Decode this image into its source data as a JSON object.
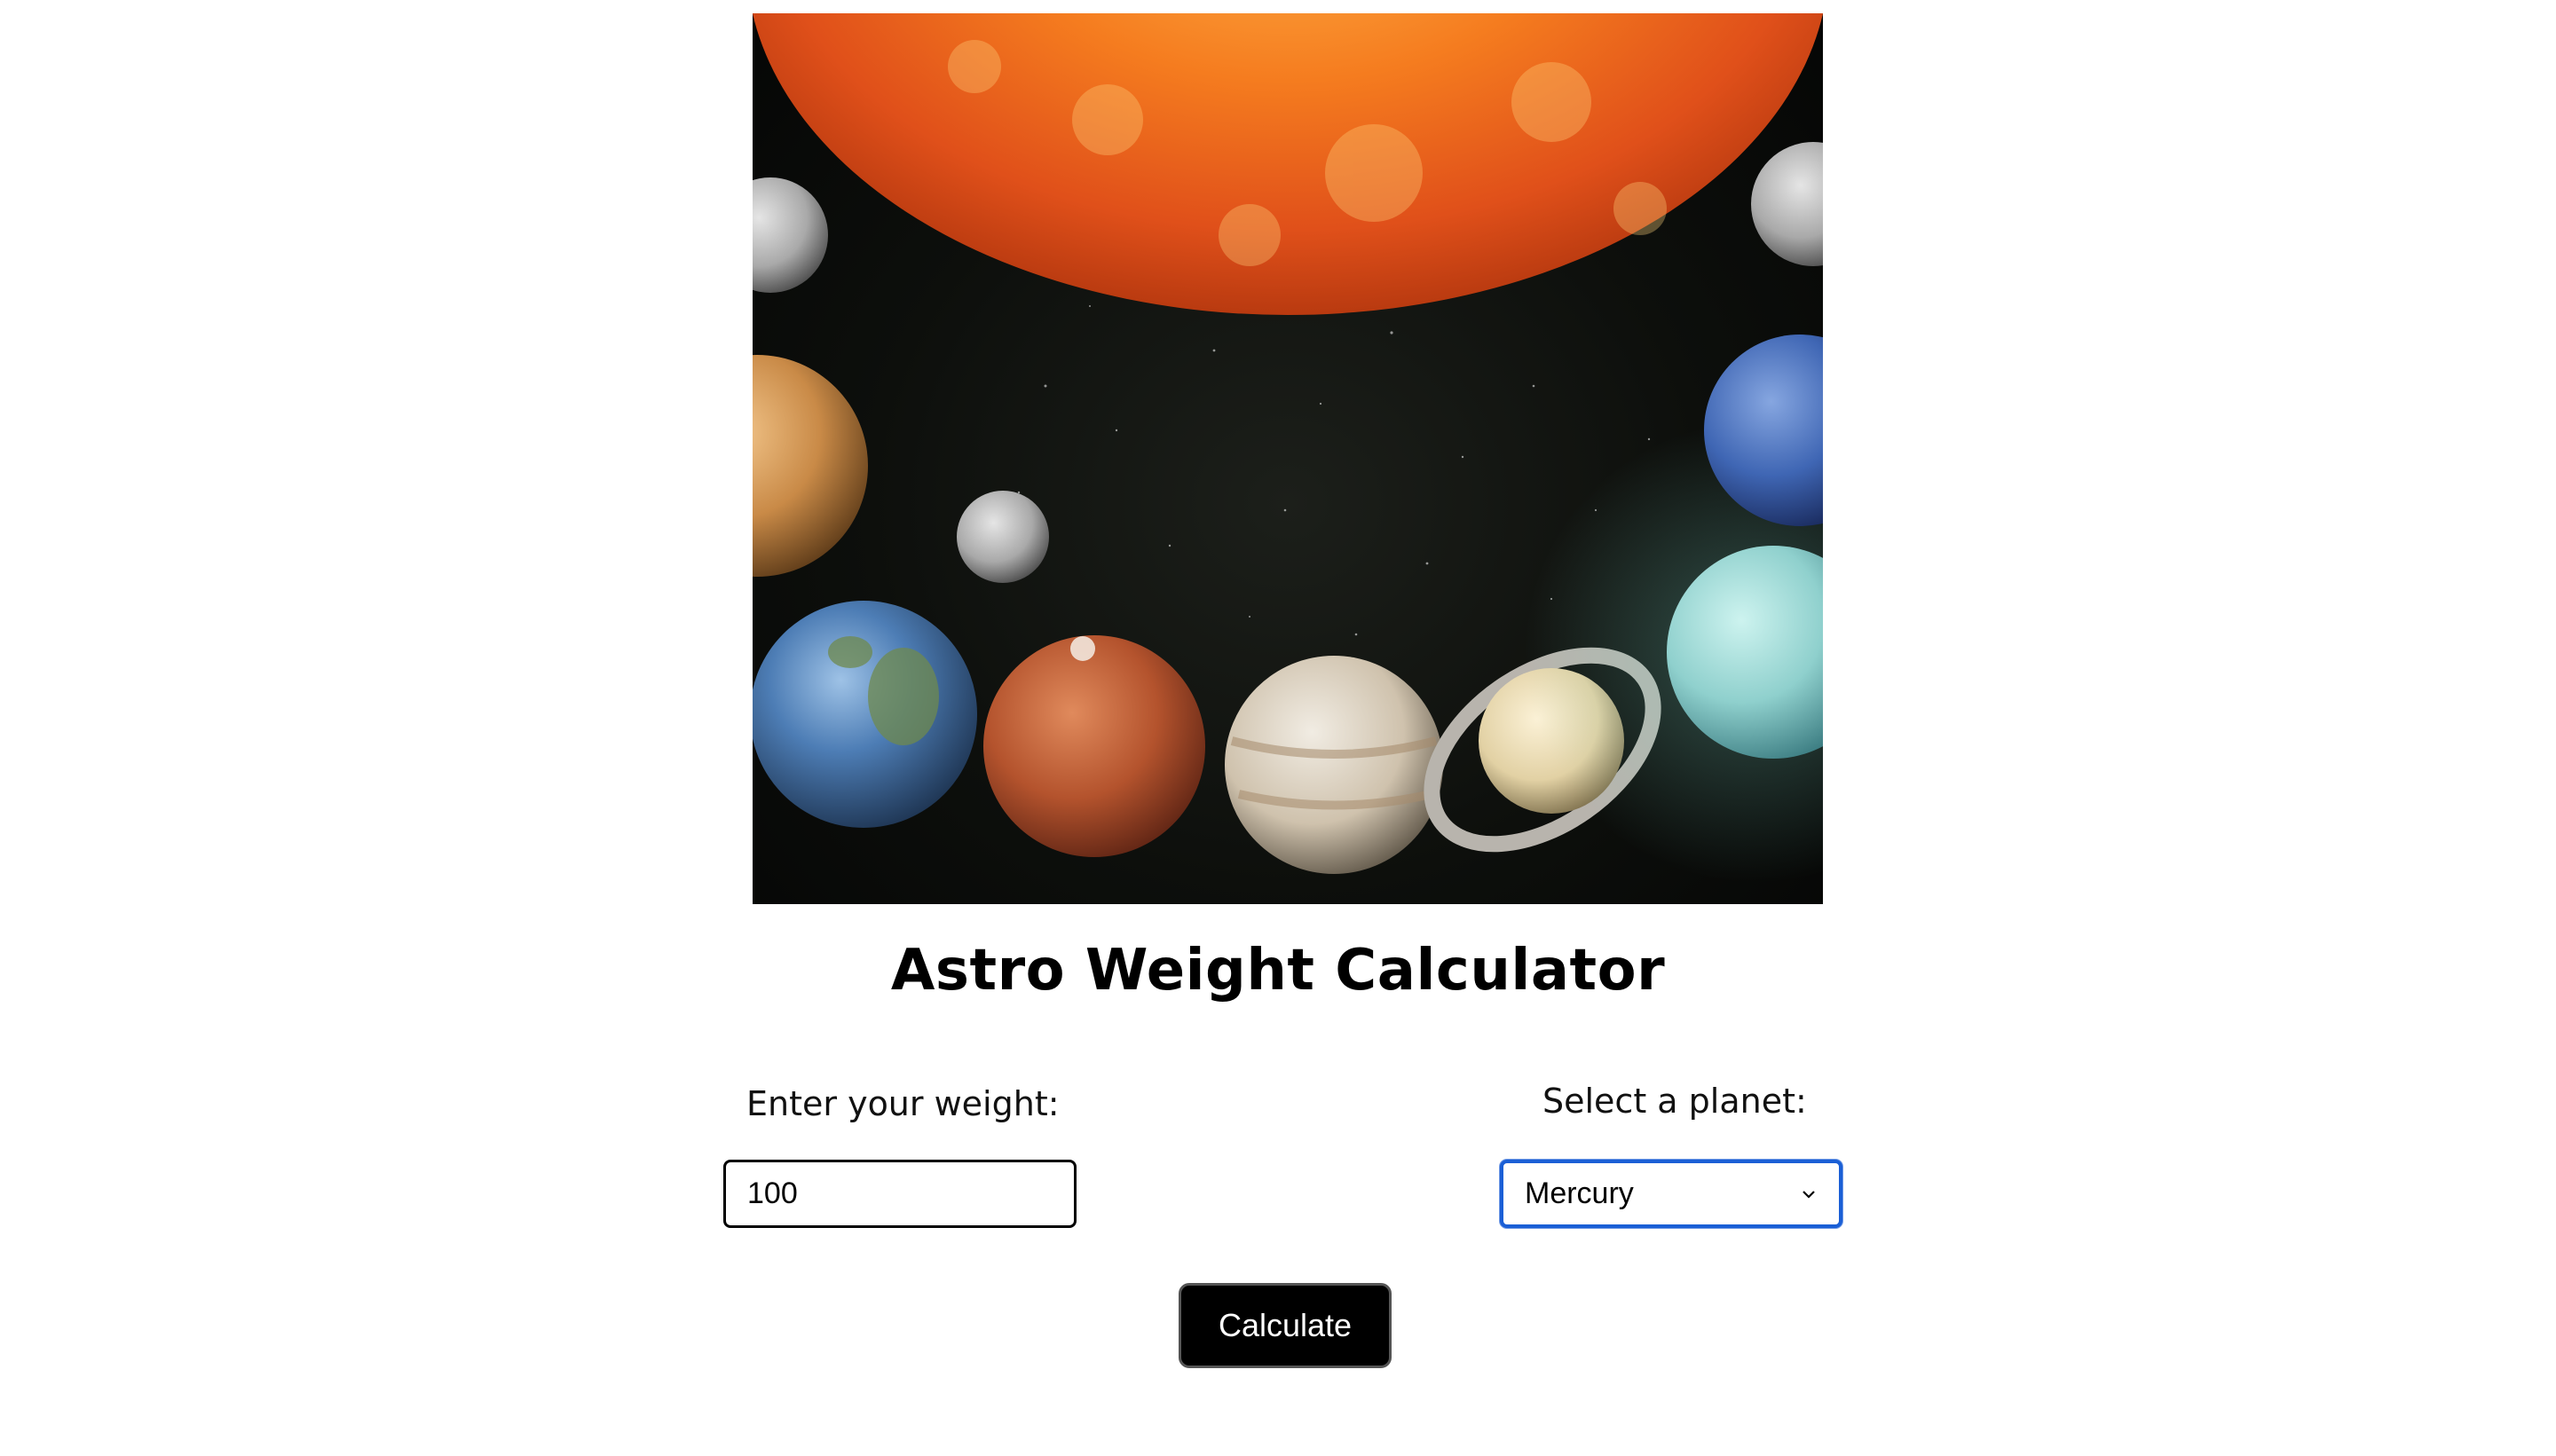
{
  "hero": {
    "image": "solar-system-planets-illustration"
  },
  "header": {
    "title": "Astro Weight Calculator"
  },
  "form": {
    "weight_label": "Enter your weight:",
    "weight_value": "100",
    "planet_label": "Select a planet:",
    "planet_selected": "Mercury",
    "submit_label": "Calculate"
  },
  "colors": {
    "select_focus_border": "#1a5fd6",
    "button_bg": "#000000",
    "button_text": "#ffffff"
  }
}
